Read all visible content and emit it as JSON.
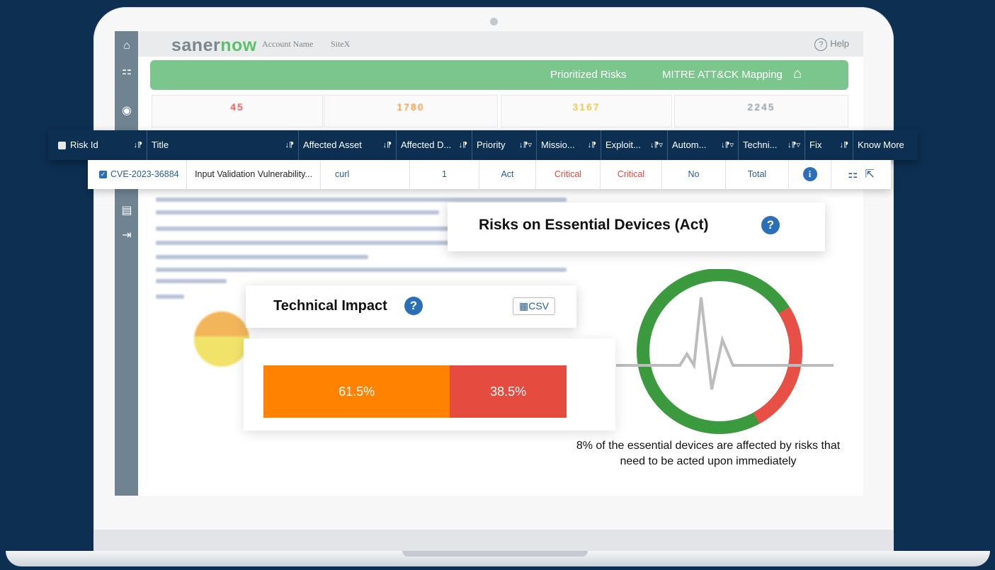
{
  "header": {
    "logo_a": "saner",
    "logo_b": "now",
    "account": "Account Name",
    "site": "SiteX",
    "help": "Help"
  },
  "nav": {
    "item1": "Prioritized Risks",
    "item2": "MITRE ATT&CK Mapping"
  },
  "stats": [
    {
      "value": "45",
      "color": "#e05a5a"
    },
    {
      "value": "1780",
      "color": "#f0a24a"
    },
    {
      "value": "3167",
      "color": "#e8c84a"
    },
    {
      "value": "2245",
      "color": "#9aa2aa"
    }
  ],
  "table": {
    "headers": [
      "Risk Id",
      "Title",
      "Affected Asset",
      "Affected D...",
      "Priority",
      "Missio...",
      "Exploit...",
      "Autom...",
      "Techni...",
      "Fix",
      "Know More"
    ],
    "row": {
      "risk_id": "CVE-2023-36884",
      "title": "Input Validation Vulnerability...",
      "asset": "curl",
      "devices": "1",
      "priority": "Act",
      "mission": "Critical",
      "exploit": "Critical",
      "automation": "No",
      "technical": "Total"
    }
  },
  "essential_card": {
    "title": "Risks on Essential Devices (Act)",
    "caption_line1": "8% of the essential devices are affected by risks that",
    "caption_line2": "need to be acted upon immediately",
    "affected_percent": 8
  },
  "technical_card": {
    "title": "Technical Impact",
    "csv": "CSV"
  },
  "impact_bar": {
    "segments": [
      {
        "label": "61.5%",
        "value": 61.5,
        "color": "#ff8300"
      },
      {
        "label": "38.5%",
        "value": 38.5,
        "color": "#e54b3f"
      }
    ]
  },
  "colors": {
    "navy": "#0d2f52",
    "green": "#7bc68d",
    "donut_green": "#3a9a3d",
    "donut_red": "#e85045"
  }
}
